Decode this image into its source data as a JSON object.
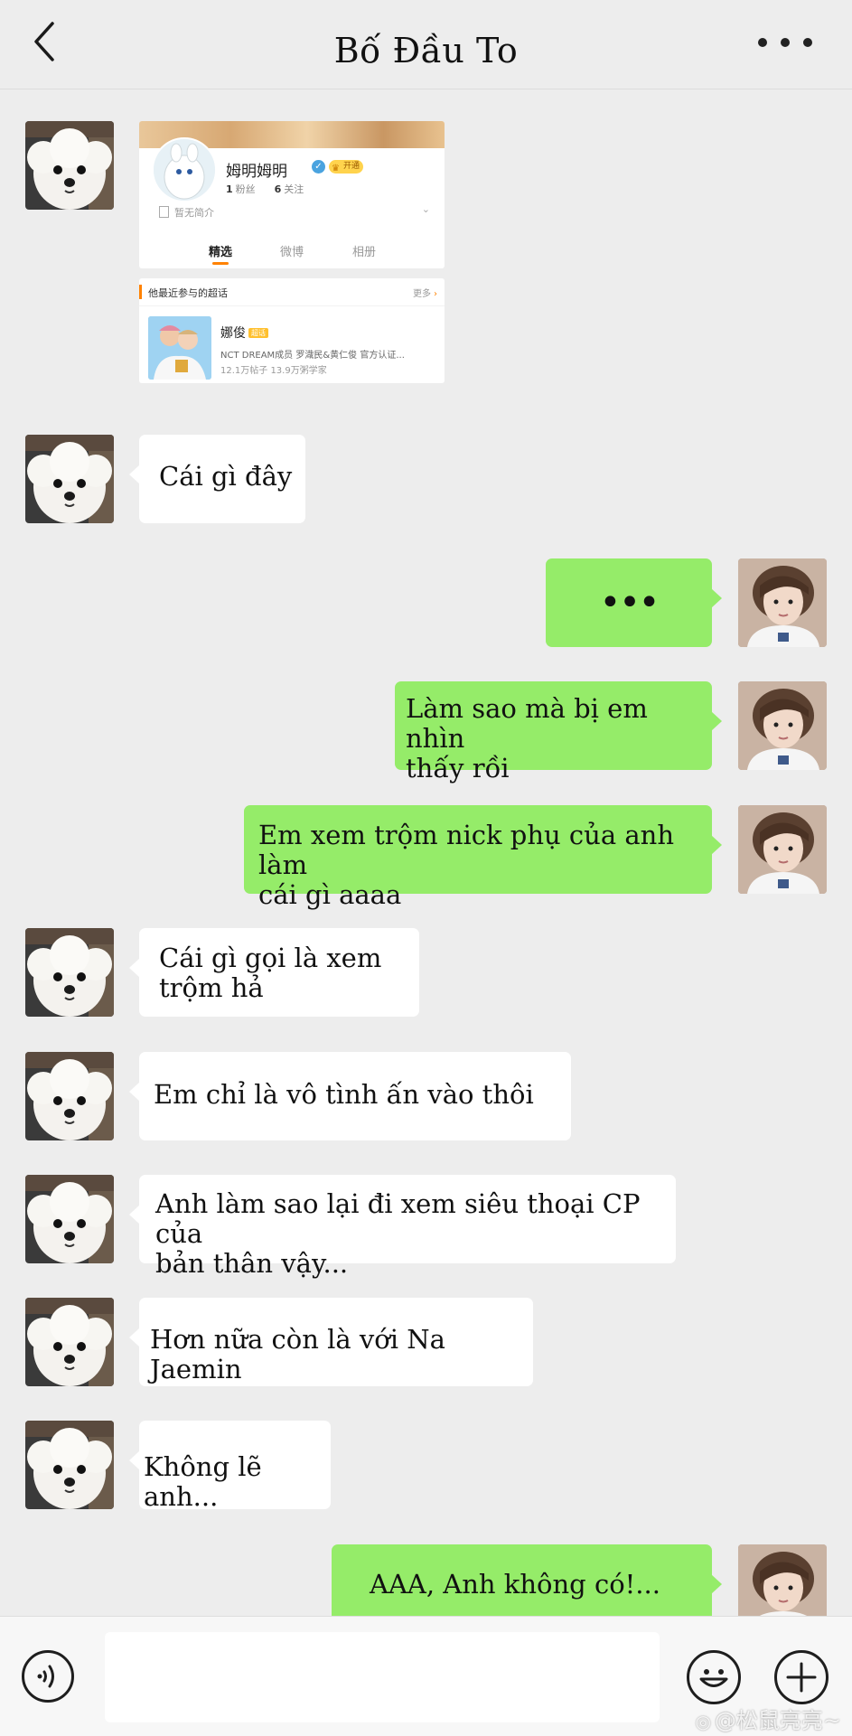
{
  "header": {
    "title": "Bố Đầu To"
  },
  "messages": {
    "m1": "Cái gì đây",
    "m2": "•••",
    "m3_line1": "Làm sao mà bị em nhìn",
    "m3_line2": "thấy rồi",
    "m4_line1": "Em xem trộm nick phụ của anh làm",
    "m4_line2": "cái gì aaaa",
    "m5_line1": "Cái gì gọi là xem",
    "m5_line2": "trộm hả",
    "m6": "Em chỉ là vô tình ấn vào thôi",
    "m7_line1": "Anh làm sao lại đi xem siêu thoại CP của",
    "m7_line2": "bản thân vậy...",
    "m8": "Hơn nữa còn là với Na Jaemin",
    "m9": "Không lẽ anh...",
    "m10": "AAA, Anh không có!..."
  },
  "card": {
    "name": "姆明姆明",
    "vip_label": "开通",
    "fans_count": "1",
    "fans_label": "粉丝",
    "follow_count": "6",
    "follow_label": "关注",
    "bio": "暂无简介",
    "tabs": [
      "精选",
      "微博",
      "相册"
    ],
    "supertopic_title": "他最近参与的超话",
    "supertopic_more": "更多",
    "topic_name": "娜俊",
    "topic_tag": "超话",
    "topic_desc": "NCT DREAM成员 罗渽民&黄仁俊 官方认证...",
    "topic_meta": "12.1万帖子 13.9万粥学家"
  },
  "input": {
    "placeholder": ""
  },
  "watermark": "@松鼠亮亮~",
  "colors": {
    "background": "#ededed",
    "outgoing_bubble": "#95ec69",
    "incoming_bubble": "#ffffff"
  }
}
